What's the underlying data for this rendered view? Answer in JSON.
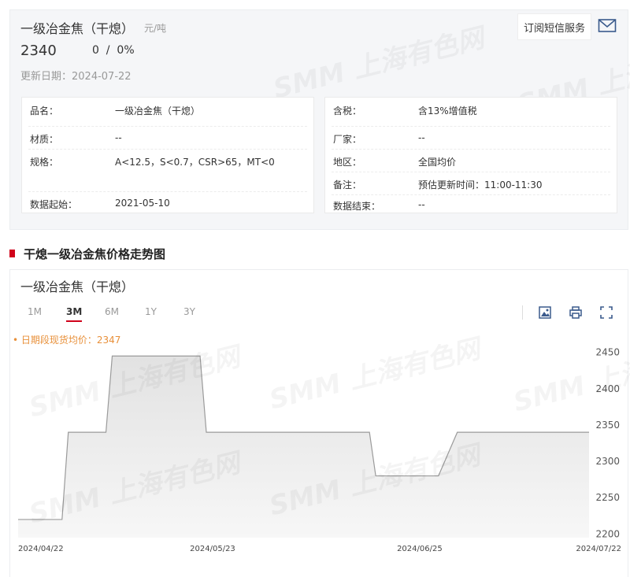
{
  "product": {
    "title": "一级冶金焦（干熄）",
    "unit": "元/吨",
    "price": "2340",
    "change": "0  /  0%",
    "update_label": "更新日期：",
    "update_date": "2024-07-22",
    "sms_button": "订阅短信服务"
  },
  "specs_left": [
    {
      "key": "品名：",
      "value": "一级冶金焦（干熄）"
    },
    {
      "key": "材质：",
      "value": "--"
    },
    {
      "key": "规格：",
      "value": "A<12.5，S<0.7，CSR>65，MT<0"
    },
    {
      "key": "数据起始：",
      "value": "2021-05-10"
    }
  ],
  "specs_right": [
    {
      "key": "含税：",
      "value": "含13%增值税"
    },
    {
      "key": "厂家：",
      "value": "--"
    },
    {
      "key": "地区：",
      "value": "全国均价"
    },
    {
      "key": "备注：",
      "value": "预估更新时间：11:00-11:30"
    },
    {
      "key": "数据结束：",
      "value": "--"
    }
  ],
  "section_title": "干熄一级冶金焦价格走势图",
  "watermark_text": "SMM 上海有色网",
  "chart_card": {
    "title": "一级冶金焦（干熄）",
    "ranges": [
      "1M",
      "3M",
      "6M",
      "1Y",
      "3Y"
    ],
    "active_range": "3M",
    "avg_note": "• 日期段现货均价：2347",
    "icons": [
      "image-download-icon",
      "print-icon",
      "fullscreen-icon"
    ]
  },
  "chart_data": {
    "type": "area",
    "series": [
      {
        "values": [
          2220,
          2220,
          2340,
          2340,
          2445,
          2445,
          2340,
          2340,
          2280,
          2280,
          2340,
          2340
        ]
      }
    ],
    "x": [
      "2024-04-22",
      "2024-04-29",
      "2024-04-30",
      "2024-05-06",
      "2024-05-07",
      "2024-05-21",
      "2024-05-22",
      "2024-06-17",
      "2024-06-18",
      "2024-06-28",
      "2024-07-01",
      "2024-07-22"
    ],
    "x_ticks": [
      "2024/04/22",
      "2024/05/23",
      "2024/06/25",
      "2024/07/22"
    ],
    "y_ticks": [
      2200,
      2250,
      2300,
      2350,
      2400,
      2450
    ],
    "ylim": [
      2195,
      2455
    ],
    "line_color": "#9a9a9a",
    "fill_color_top": "#e2e2e2",
    "fill_color_bottom": "#f7f7f7",
    "grid": false
  }
}
